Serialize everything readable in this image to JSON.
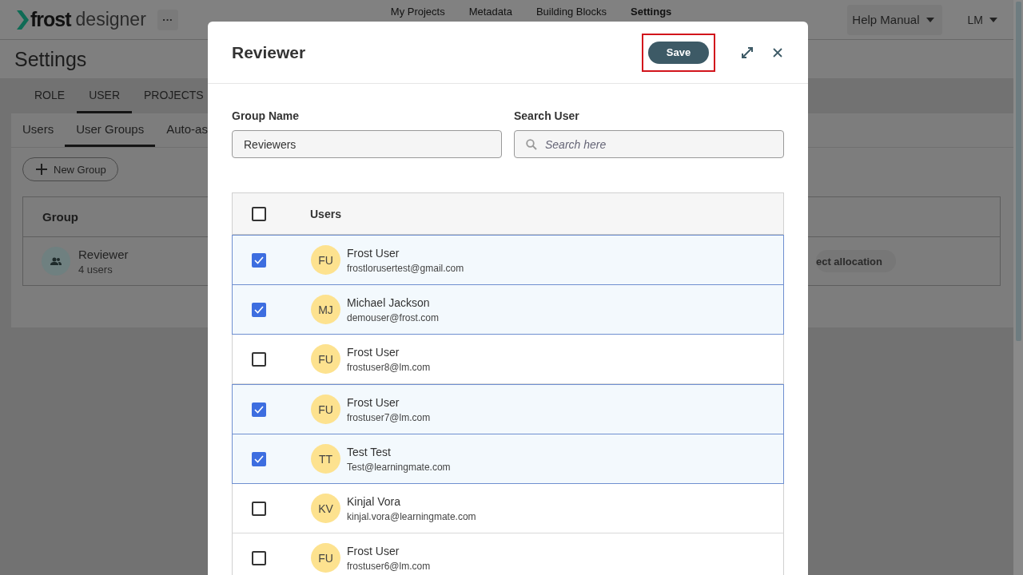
{
  "app_bar": {
    "logo": {
      "bold": "frost",
      "light": "designer"
    },
    "more_button": "···",
    "nav": [
      {
        "label": "My Projects",
        "selected": false
      },
      {
        "label": "Metadata",
        "selected": false
      },
      {
        "label": "Building Blocks",
        "selected": false
      },
      {
        "label": "Settings",
        "selected": true
      }
    ],
    "help_menu": "Help Manual",
    "user_menu": "LM"
  },
  "page_title": "Settings",
  "tabs": [
    {
      "label": "ROLE",
      "selected": false
    },
    {
      "label": "USER",
      "selected": true
    },
    {
      "label": "PROJECTS",
      "selected": false
    }
  ],
  "sub_tabs": [
    {
      "label": "Users",
      "selected": false
    },
    {
      "label": "User Groups",
      "selected": true
    },
    {
      "label": "Auto-as",
      "selected": false
    }
  ],
  "new_group_button": "New Group",
  "groups_table": {
    "columns": [
      "Group"
    ],
    "rows": [
      {
        "name": "Reviewer",
        "count": "4 users",
        "action": "ect allocation"
      }
    ]
  },
  "dialog": {
    "title": "Reviewer",
    "save_button": {
      "label": "Save",
      "highlighted": true
    },
    "group_name": {
      "label": "Group Name",
      "value": "Reviewers"
    },
    "search_user": {
      "label": "Search User",
      "placeholder": "Search here"
    },
    "users_table": {
      "header": "Users",
      "all_checked": false,
      "rows": [
        {
          "initials": "FU",
          "name": "Frost User",
          "email": "frostlorusertest@gmail.com",
          "checked": true
        },
        {
          "initials": "MJ",
          "name": "Michael Jackson",
          "email": "demouser@frost.com",
          "checked": true
        },
        {
          "initials": "FU",
          "name": "Frost User",
          "email": "frostuser8@lm.com",
          "checked": false
        },
        {
          "initials": "FU",
          "name": "Frost User",
          "email": "frostuser7@lm.com",
          "checked": true
        },
        {
          "initials": "TT",
          "name": "Test Test",
          "email": "Test@learningmate.com",
          "checked": true
        },
        {
          "initials": "KV",
          "name": "Kinjal Vora",
          "email": "kinjal.vora@learningmate.com",
          "checked": false
        },
        {
          "initials": "FU",
          "name": "Frost User",
          "email": "frostuser6@lm.com",
          "checked": false
        }
      ]
    }
  }
}
